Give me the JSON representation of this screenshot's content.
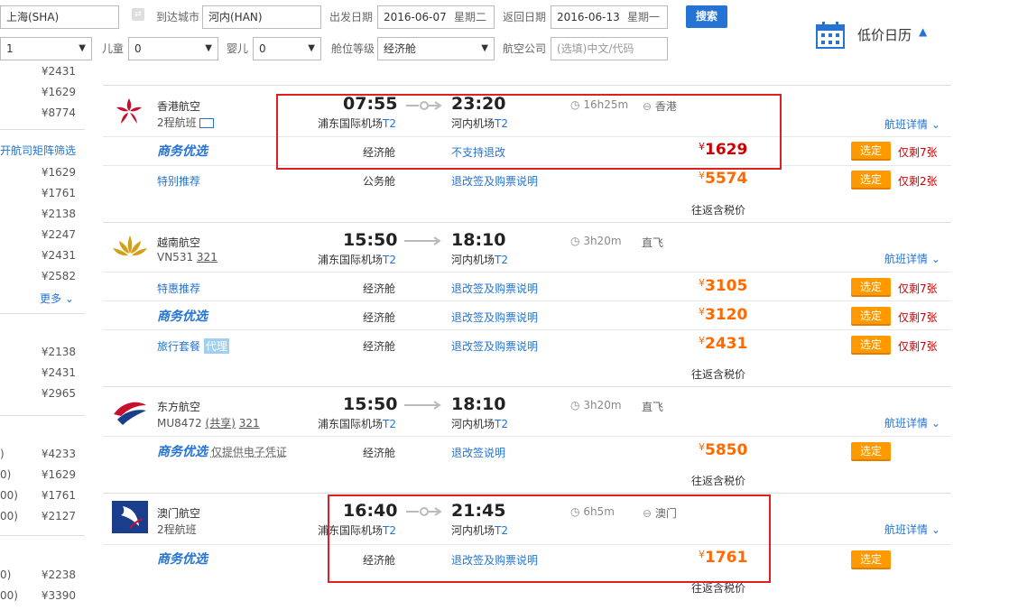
{
  "search": {
    "from_city": "上海(SHA)",
    "to_label": "到达城市",
    "to_city": "河内(HAN)",
    "depart_label": "出发日期",
    "depart_date": "2016-06-07",
    "depart_day": "星期二",
    "return_label": "返回日期",
    "return_date": "2016-06-13",
    "return_day": "星期一",
    "search_button": "搜索",
    "adults": "1",
    "child_label": "儿童",
    "children": "0",
    "infant_label": "婴儿",
    "infants": "0",
    "cabin_label": "舱位等级",
    "cabin": "经济舱",
    "airline_label": "航空公司",
    "airline_placeholder": "(选填)中文/代码",
    "calendar_title": "低价日历"
  },
  "sidebar": {
    "prices_a": [
      "¥2431",
      "¥1629",
      "¥8774"
    ],
    "filter_link": "开航司矩阵筛选",
    "prices_b": [
      "¥1629",
      "¥1761",
      "¥2138",
      "¥2247",
      "¥2431",
      "¥2582"
    ],
    "more_link": "更多",
    "prices_c": [
      "¥2138",
      "¥2431",
      "¥2965"
    ],
    "prices_d": [
      {
        "left": ")",
        "price": "¥4233"
      },
      {
        "left": "0)",
        "price": "¥1629"
      },
      {
        "left": "00)",
        "price": "¥1761"
      },
      {
        "left": "00)",
        "price": "¥2127"
      }
    ],
    "prices_e": [
      {
        "left": "0)",
        "price": "¥2238"
      },
      {
        "left": "00)",
        "price": "¥3390"
      }
    ]
  },
  "flights": [
    {
      "airline": "香港航空",
      "fno": "2程航班",
      "dep_time": "07:55",
      "dep_airport": "浦东国际机场",
      "dep_term": "T2",
      "arr_time": "23:20",
      "arr_airport": "河内机场",
      "arr_term": "T2",
      "duration": "16h25m",
      "stop": "香港",
      "detail": "航班详情",
      "fares": [
        {
          "type": "商务优选",
          "cabin": "经济舱",
          "rule": "不支持退改",
          "price": "1629",
          "pick": "选定",
          "left": "仅剩7张"
        },
        {
          "type": "特别推荐",
          "cabin": "公务舱",
          "rule": "退改签及购票说明",
          "price": "5574",
          "pick": "选定",
          "left": "仅剩2张"
        }
      ],
      "tax": "往返含税价"
    },
    {
      "airline": "越南航空",
      "fno": "VN531",
      "plane": "321",
      "dep_time": "15:50",
      "dep_airport": "浦东国际机场",
      "dep_term": "T2",
      "arr_time": "18:10",
      "arr_airport": "河内机场",
      "arr_term": "T2",
      "duration": "3h20m",
      "stop": "直飞",
      "detail": "航班详情",
      "fares": [
        {
          "type": "特惠推荐",
          "cabin": "经济舱",
          "rule": "退改签及购票说明",
          "price": "3105",
          "pick": "选定",
          "left": "仅剩7张"
        },
        {
          "type": "商务优选",
          "cabin": "经济舱",
          "rule": "退改签及购票说明",
          "price": "3120",
          "pick": "选定",
          "left": "仅剩7张"
        },
        {
          "type": "旅行套餐",
          "agent": "代理",
          "cabin": "经济舱",
          "rule": "退改签及购票说明",
          "price": "2431",
          "pick": "选定",
          "left": "仅剩7张"
        }
      ],
      "tax": "往返含税价"
    },
    {
      "airline": "东方航空",
      "fno": "MU8472",
      "share": "(共享)",
      "plane": "321",
      "dep_time": "15:50",
      "dep_airport": "浦东国际机场",
      "dep_term": "T2",
      "arr_time": "18:10",
      "arr_airport": "河内机场",
      "arr_term": "T2",
      "duration": "3h20m",
      "stop": "直飞",
      "detail": "航班详情",
      "fares": [
        {
          "type": "商务优选",
          "note": "仅提供电子凭证",
          "cabin": "经济舱",
          "rule": "退改签说明",
          "price": "5850",
          "pick": "选定"
        }
      ],
      "tax": "往返含税价"
    },
    {
      "airline": "澳门航空",
      "fno": "2程航班",
      "dep_time": "16:40",
      "dep_airport": "浦东国际机场",
      "dep_term": "T2",
      "arr_time": "21:45",
      "arr_airport": "河内机场",
      "arr_term": "T2",
      "duration": "6h5m",
      "stop": "澳门",
      "detail": "航班详情",
      "fares": [
        {
          "type": "商务优选",
          "cabin": "经济舱",
          "rule": "退改签及购票说明",
          "price": "1761",
          "pick": "选定"
        }
      ],
      "tax": "往返含税价"
    }
  ],
  "colors": {
    "link": "#2574d4",
    "price": "#ff6a00",
    "price_red": "#cc0000",
    "pick": "#ff9900",
    "highlight": "#e02020"
  }
}
